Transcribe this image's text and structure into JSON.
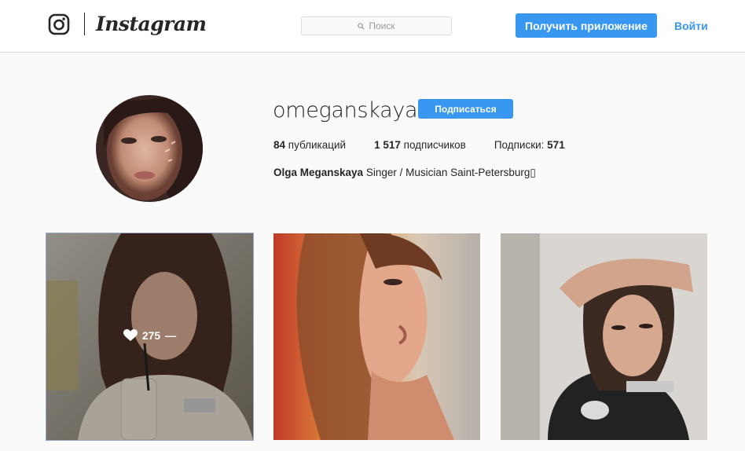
{
  "header": {
    "logo_icon": "instagram-camera-icon",
    "wordmark": "Instagram",
    "search_placeholder": "Поиск",
    "get_app_label": "Получить приложение",
    "login_label": "Войти"
  },
  "profile": {
    "username": "omeganskaya",
    "follow_label": "Подписаться",
    "stats": {
      "posts_count": "84",
      "posts_label": "публикаций",
      "followers_count": "1 517",
      "followers_label": "подписчиков",
      "following_label": "Подписки:",
      "following_count": "571"
    },
    "bio_name": "Olga Meganskaya",
    "bio_text": "Singer / Musician Saint-Petersburg▯"
  },
  "posts": [
    {
      "likes": "275",
      "comments": "—",
      "hovered": true
    },
    {
      "hovered": false
    },
    {
      "hovered": false
    }
  ],
  "colors": {
    "accent": "#3897f0",
    "background": "#fafafa",
    "text": "#262626"
  }
}
